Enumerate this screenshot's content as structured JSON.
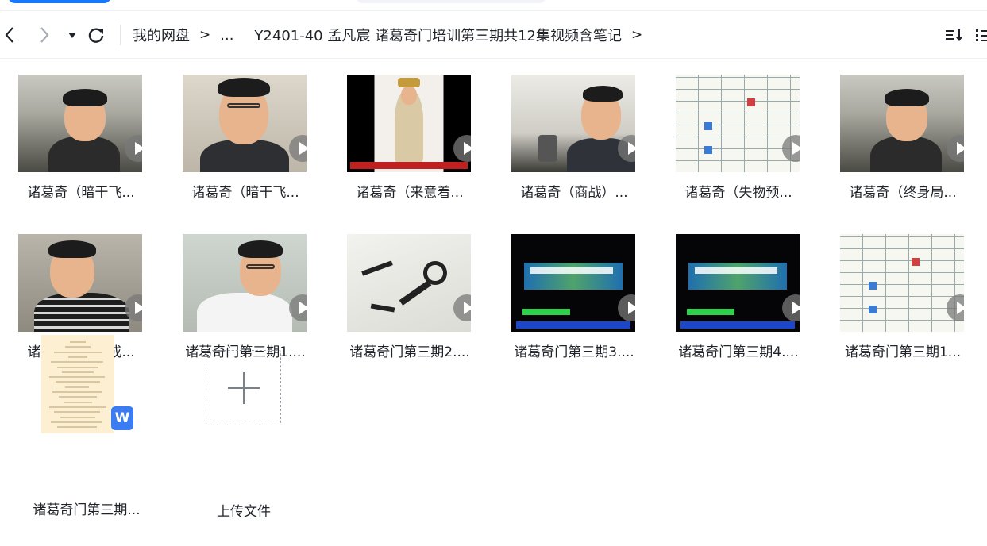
{
  "toolbar": {
    "back_icon": "chevron-left-icon",
    "forward_icon": "chevron-right-icon",
    "dropdown_icon": "caret-down-icon",
    "refresh_icon": "refresh-icon",
    "breadcrumb": [
      "我的网盘",
      "...",
      "Y2401-40 孟凡宸 诸葛奇门培训第三期共12集视频含笔记"
    ],
    "sort_icon": "sort-icon",
    "view_icon": "list-view-icon"
  },
  "files": [
    {
      "name": "诸葛奇（暗干飞...",
      "type": "video",
      "scene": "man-office"
    },
    {
      "name": "诸葛奇（暗干飞...",
      "type": "video",
      "scene": "man-close"
    },
    {
      "name": "诸葛奇（来意着...",
      "type": "video",
      "scene": "figure"
    },
    {
      "name": "诸葛奇（商战）...",
      "type": "video",
      "scene": "man-side"
    },
    {
      "name": "诸葛奇（失物预...",
      "type": "video",
      "scene": "chart"
    },
    {
      "name": "诸葛奇（终身局...",
      "type": "video",
      "scene": "man-office"
    },
    {
      "name": "诸葛奇门第《成...",
      "type": "video",
      "scene": "man-laugh"
    },
    {
      "name": "诸葛奇门第三期1....",
      "type": "video",
      "scene": "man-white"
    },
    {
      "name": "诸葛奇门第三期2....",
      "type": "video",
      "scene": "calligraphy"
    },
    {
      "name": "诸葛奇门第三期3....",
      "type": "video",
      "scene": "title-card"
    },
    {
      "name": "诸葛奇门第三期4....",
      "type": "video",
      "scene": "title-card"
    },
    {
      "name": "诸葛奇门第三期1...",
      "type": "video",
      "scene": "chart"
    },
    {
      "name": "诸葛奇门第三期...",
      "type": "document",
      "badge": "W"
    }
  ],
  "upload": {
    "label": "上传文件",
    "icon": "plus-icon"
  },
  "colors": {
    "accent": "#1677ff",
    "doc_bg": "#fdf0d2",
    "wps": "#3b7cf3"
  }
}
